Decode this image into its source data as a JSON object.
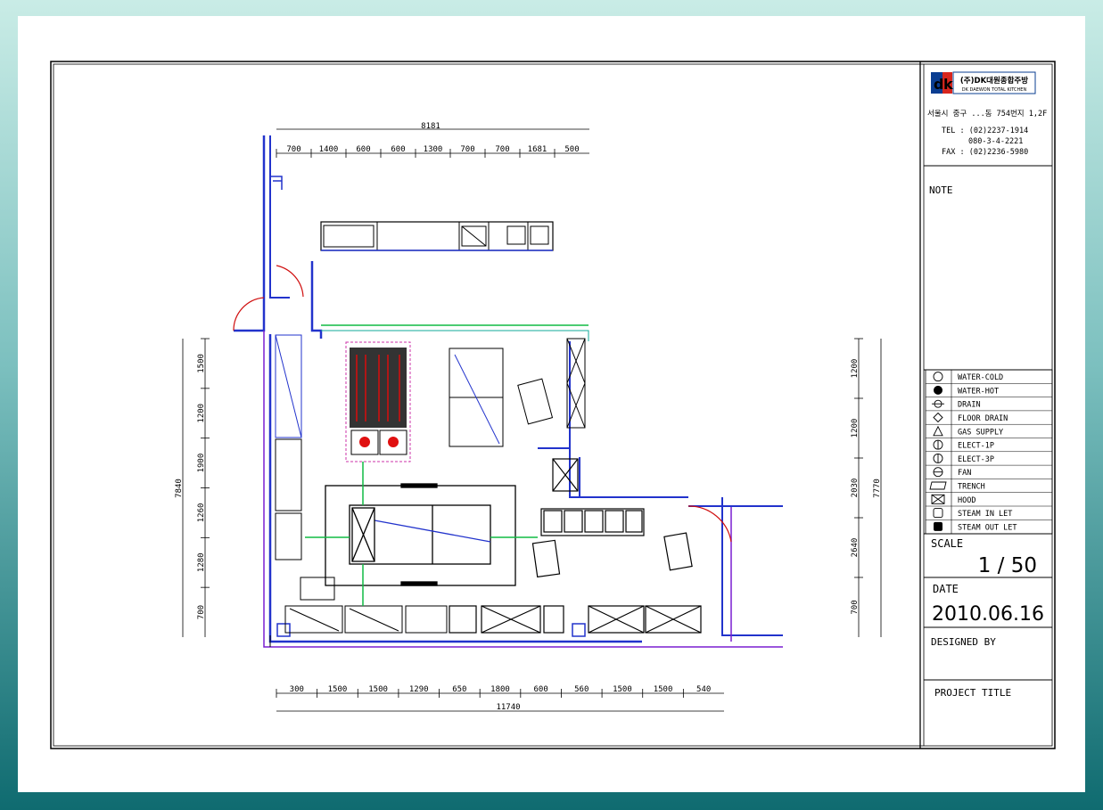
{
  "company": {
    "logo_text": "(주)DK대원종합주방",
    "logo_sub": "DK DAEWON TOTAL KITCHEN",
    "address": "서울시 중구 ...동 754번지 1,2F",
    "tel": "TEL : (02)2237-1914",
    "mobile": "080-3-4-2221",
    "fax": "FAX : (02)2236-5980"
  },
  "title_block": {
    "note_label": "NOTE",
    "scale_label": "SCALE",
    "scale_value": "1 / 50",
    "date_label": "DATE",
    "date_value": "2010.06.16",
    "designed_label": "DESIGNED BY",
    "project_label": "PROJECT TITLE"
  },
  "legend": [
    {
      "symbol": "water-cold-symbol",
      "label": "WATER-COLD"
    },
    {
      "symbol": "water-hot-symbol",
      "label": "WATER-HOT"
    },
    {
      "symbol": "drain-symbol",
      "label": "DRAIN"
    },
    {
      "symbol": "floor-drain-symbol",
      "label": "FLOOR DRAIN"
    },
    {
      "symbol": "gas-supply-symbol",
      "label": "GAS SUPPLY"
    },
    {
      "symbol": "elect-1p-symbol",
      "label": "ELECT-1P"
    },
    {
      "symbol": "elect-3p-symbol",
      "label": "ELECT-3P"
    },
    {
      "symbol": "fan-symbol",
      "label": "FAN"
    },
    {
      "symbol": "trench-symbol",
      "label": "TRENCH"
    },
    {
      "symbol": "hood-symbol",
      "label": "HOOD"
    },
    {
      "symbol": "steam-inlet-symbol",
      "label": "STEAM IN LET"
    },
    {
      "symbol": "steam-outlet-symbol",
      "label": "STEAM OUT LET"
    }
  ],
  "dimensions": {
    "top_total": "8181",
    "top": [
      "700",
      "1400",
      "600",
      "600",
      "1300",
      "700",
      "700",
      "1681",
      "500"
    ],
    "bottom": [
      "300",
      "1500",
      "1500",
      "1290",
      "650",
      "1800",
      "600",
      "560",
      "1500",
      "1500",
      "540"
    ],
    "bottom_total": "11740",
    "left_total": "7840",
    "left": [
      "1500",
      "1200",
      "1900",
      "1260",
      "1280",
      "700"
    ],
    "right_total": "7770",
    "right": [
      "1200",
      "1200",
      "2030",
      "2640",
      "700"
    ]
  }
}
